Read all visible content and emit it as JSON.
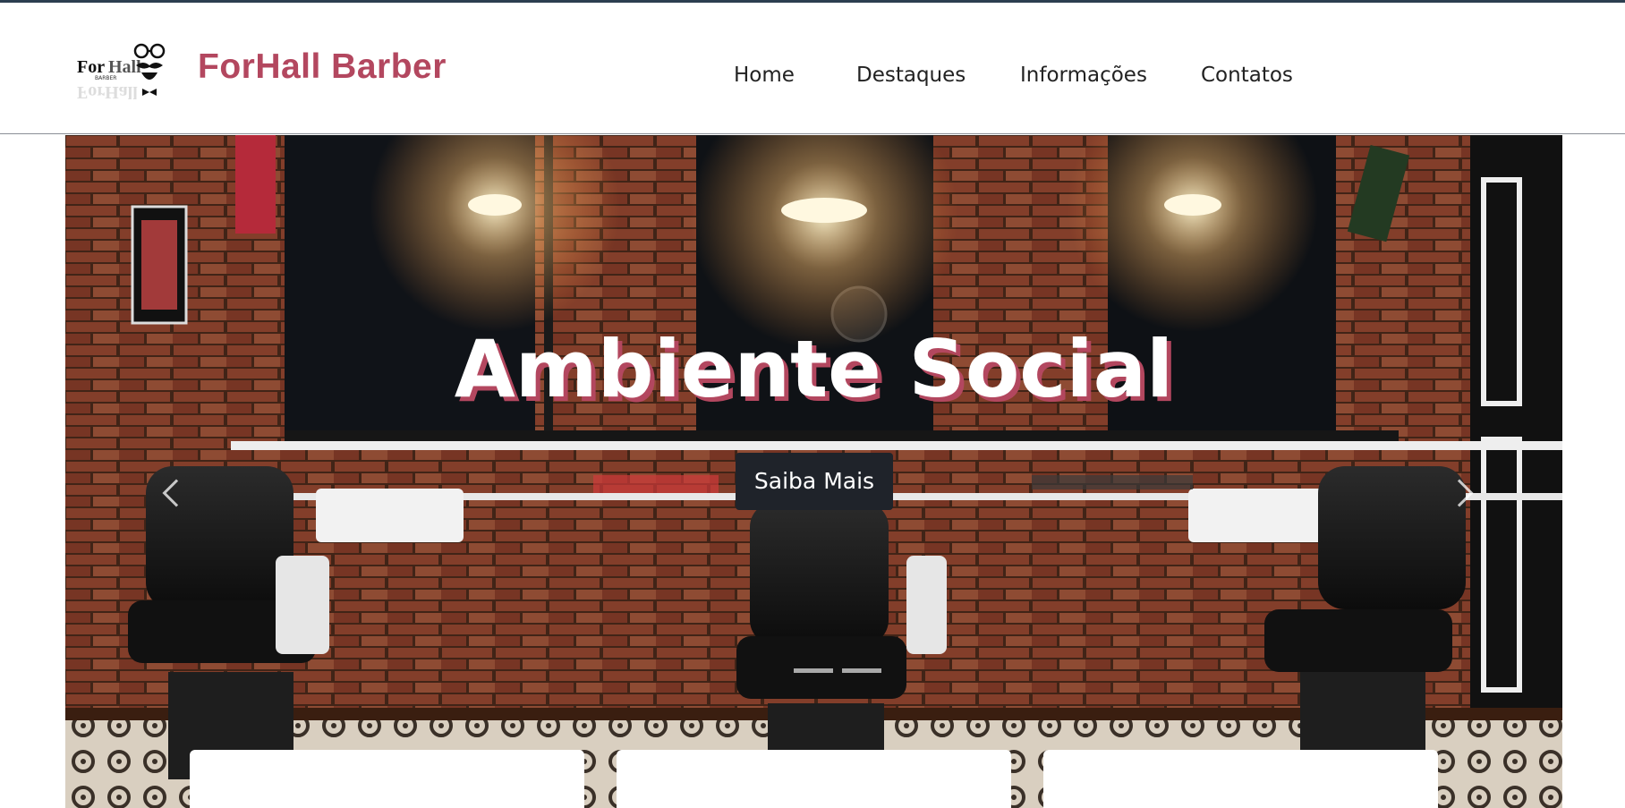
{
  "brand": {
    "logo_icon": "forhall-mustache-glasses-logo",
    "logo_text": "ForHall",
    "logo_subtext": "BARBER",
    "name": "ForHall Barber",
    "color": "#b3475f"
  },
  "nav": {
    "items": [
      {
        "label": "Home"
      },
      {
        "label": "Destaques"
      },
      {
        "label": "Informações"
      },
      {
        "label": "Contatos"
      }
    ]
  },
  "carousel": {
    "slide_title": "Ambiente Social",
    "cta_label": "Saiba Mais",
    "prev_icon": "chevron-left-icon",
    "next_icon": "chevron-right-icon",
    "slide_count": 2,
    "active_slide": 1
  },
  "cards": [
    {
      "title": ""
    },
    {
      "title": ""
    },
    {
      "title": ""
    }
  ],
  "colors": {
    "accent": "#b3475f",
    "button_bg": "#1f232a",
    "nav_text": "#222222"
  }
}
